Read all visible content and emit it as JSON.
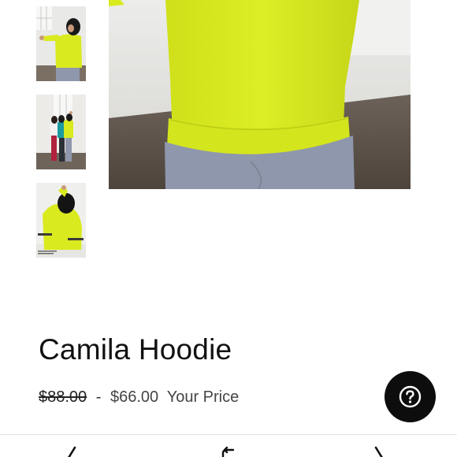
{
  "product": {
    "title": "Camila Hoodie",
    "original_price": "$88.00",
    "separator": "-",
    "sale_price": "$66.00",
    "price_suffix": "Your Price"
  },
  "gallery": {
    "thumbnail_count": 3,
    "thumbnails": [
      {
        "name": "thumb-front-arm-raised"
      },
      {
        "name": "thumb-group-three-models"
      },
      {
        "name": "thumb-side-pose-with-labels"
      }
    ],
    "main_image": "hoodie-closeup"
  },
  "colors": {
    "hoodie": "#d9ea1f",
    "leggings": "#8f97ac",
    "help_button": "#0d0d0d",
    "floor": "#5b5148"
  },
  "help": {
    "icon": "question-mark-icon"
  },
  "bottom_nav": {
    "back_icon": "chevron-left-icon",
    "share_icon": "share-icon",
    "forward_icon": "chevron-right-icon"
  }
}
